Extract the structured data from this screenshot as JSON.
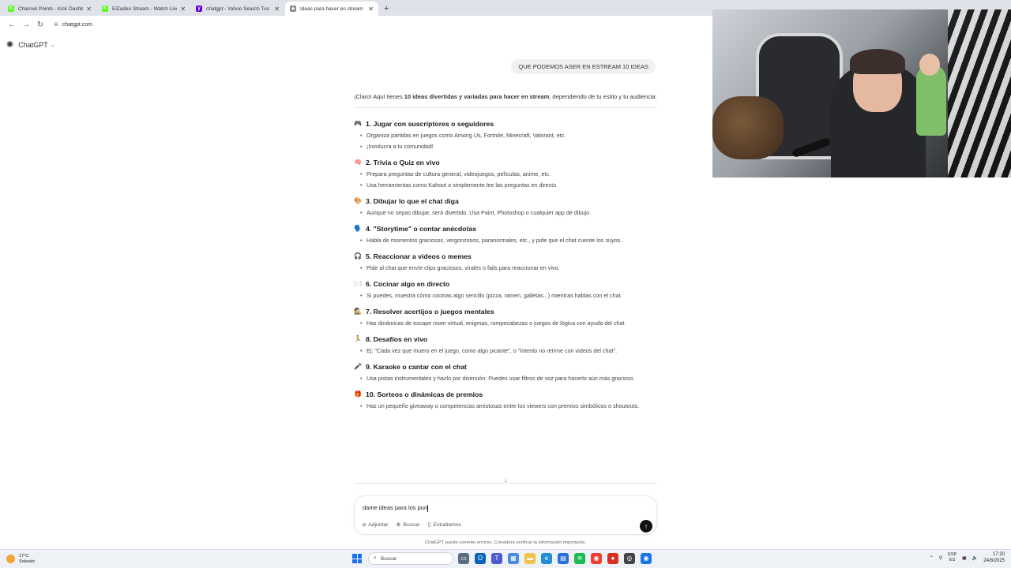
{
  "browser": {
    "tabs": [
      {
        "title": "Channel Points - Kick Dashboard",
        "favicon_color": "#53fc18",
        "favicon_glyph": "K"
      },
      {
        "title": "ElZadeo Stream - Watch Live on Kick",
        "favicon_color": "#53fc18",
        "favicon_glyph": "K"
      },
      {
        "title": "chatgpt - Yahoo Search Tus resultados",
        "favicon_color": "#6001d2",
        "favicon_glyph": "y"
      },
      {
        "title": "Ideas para hacer en stream",
        "favicon_color": "#888888",
        "favicon_glyph": "✺",
        "active": true
      }
    ],
    "url": "chatgpt.com"
  },
  "app": {
    "name": "ChatGPT"
  },
  "user_message": "QUE PODEMOS ASER EN ESTREAM 10 IDEAS",
  "answer": {
    "intro_prefix": "¡Claro! Aquí tienes ",
    "intro_bold": "10 ideas divertidas y variadas para hacer en stream",
    "intro_suffix": ", dependiendo de tu estilo y tu audiencia:",
    "ideas": [
      {
        "emoji": "🎮",
        "title": "1. Jugar con suscriptores o seguidores",
        "bullets": [
          "Organiza partidas en juegos como Among Us, Fortnite, Minecraft, Valorant, etc.",
          "¡Involucra a tu comunidad!"
        ]
      },
      {
        "emoji": "🧠",
        "title": "2. Trivia o Quiz en vivo",
        "bullets": [
          "Prepara preguntas de cultura general, videojuegos, películas, anime, etc.",
          "Usa herramientas como Kahoot o simplemente lee las preguntas en directo."
        ]
      },
      {
        "emoji": "🎨",
        "title": "3. Dibujar lo que el chat diga",
        "bullets": [
          "Aunque no sepas dibujar, será divertido. Usa Paint, Photoshop o cualquier app de dibujo."
        ]
      },
      {
        "emoji": "🗣️",
        "title": "4. \"Storytime\" o contar anécdotas",
        "bullets": [
          "Habla de momentos graciosos, vergonzosos, paranormales, etc., y pide que el chat cuente los suyos."
        ]
      },
      {
        "emoji": "🎧",
        "title": "5. Reaccionar a videos o memes",
        "bullets": [
          "Pide al chat que envíe clips graciosos, virales o fails para reaccionar en vivo."
        ]
      },
      {
        "emoji": "🍽️",
        "title": "6. Cocinar algo en directo",
        "bullets": [
          "Si puedes, muestra cómo cocinas algo sencillo (pizza, ramen, galletas...) mientras hablas con el chat."
        ]
      },
      {
        "emoji": "🕵️",
        "title": "7. Resolver acertijos o juegos mentales",
        "bullets": [
          "Haz dinámicas de escape room virtual, enigmas, rompecabezas o juegos de lógica con ayuda del chat."
        ]
      },
      {
        "emoji": "🏃",
        "title": "8. Desafíos en vivo",
        "bullets": [
          "Ej: \"Cada vez que muero en el juego, como algo picante\", o \"Intento no reírme con videos del chat\"."
        ]
      },
      {
        "emoji": "🎤",
        "title": "9. Karaoke o cantar con el chat",
        "bullets": [
          "Usa pistas instrumentales y hazlo por diversión. Puedes usar filtros de voz para hacerlo aún más gracioso."
        ]
      },
      {
        "emoji": "🎁",
        "title": "10. Sorteos o dinámicas de premios",
        "bullets": [
          "Haz un pequeño giveaway o competencias amistosas entre los viewers con premios simbólicos o shoutouts."
        ]
      }
    ]
  },
  "composer": {
    "value": "dame ideas para los pun",
    "tools": [
      {
        "icon": "paperclip-icon",
        "label": "Adjuntar"
      },
      {
        "icon": "globe-icon",
        "label": "Buscar"
      },
      {
        "icon": "book-icon",
        "label": "Estudiemos"
      }
    ],
    "disclaimer": "ChatGPT puede cometer errores. Considera verificar la información importante."
  },
  "taskbar": {
    "weather_temp": "17°C",
    "weather_desc": "Soleado",
    "search_placeholder": "Buscar",
    "lang_top": "ESP",
    "lang_bottom": "ES",
    "time": "17:20",
    "date": "24/8/2025"
  }
}
